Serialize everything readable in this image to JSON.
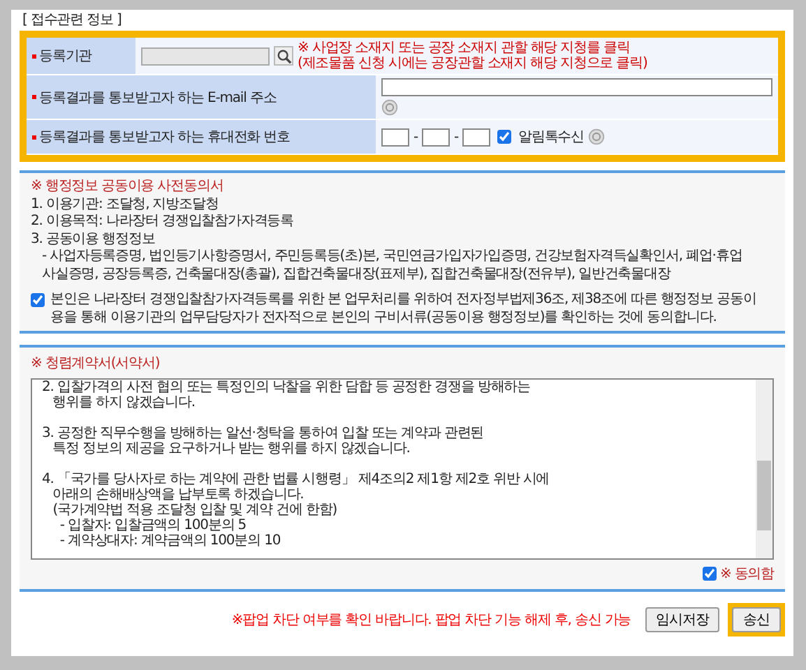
{
  "section_title": "[ 접수관련 정보 ]",
  "form": {
    "highlighted": true,
    "rows": [
      {
        "kind": "agency",
        "label": "등록기관",
        "required": true,
        "notes": [
          "※ 사업장 소재지 또는 공장 소재지 관할 해당 지청를 클릭",
          "(제조물품 신청 시에는 공장관할 소재지 해당 지청으로 클릭)"
        ]
      },
      {
        "kind": "email",
        "label": "등록결과를 통보받고자 하는 E-mail 주소",
        "required": true
      },
      {
        "kind": "phone",
        "label": "등록결과를 통보받고자 하는 휴대전화 번호",
        "required": true,
        "separators": [
          "-",
          "-"
        ],
        "sms": {
          "label": "알림톡수신",
          "checked": true
        }
      }
    ]
  },
  "consent": {
    "title": "※ 행정정보 공동이용 사전동의서",
    "lines": [
      {
        "kind": "item",
        "text": "1. 이용기관: 조달청, 지방조달청"
      },
      {
        "kind": "item",
        "text": "2. 이용목적: 나라장터 경쟁입찰참가자격등록"
      },
      {
        "kind": "item",
        "text": "3. 공동이용 행정정보"
      },
      {
        "kind": "sub",
        "text": "- 사업자등록증명, 법인등기사항증명서, 주민등록등(초)본, 국민연금가입자가입증명, 건강보험자격득실확인서, 폐업·휴업사실증명, 공장등록증, 건축물대장(총괄), 집합건축물대장(표제부), 집합건축물대장(전유부), 일반건축물대장"
      }
    ],
    "agree": {
      "checked": true,
      "text": "본인은 나라장터 경쟁입찰참가자격등록를 위한 본 업무처리를 위하여 전자정부법제36조, 제38조에 따른 행정정보 공동이용을 통해 이용기관의 업무담당자가 전자적으로 본인의 구비서류(공동이용 행정정보)를 확인하는 것에 동의합니다."
    }
  },
  "pledge": {
    "title": "※ 청렴계약서(서약서)",
    "paragraphs": [
      [
        "2. 입찰가격의 사전 협의 또는 특정인의 낙찰을 위한 담합 등 공정한 경쟁을 방해하는",
        "   행위를 하지 않겠습니다."
      ],
      [
        "3. 공정한 직무수행을 방해하는 알선·청탁을 통하여 입찰 또는 계약과 관련된",
        "   특정 정보의 제공을 요구하거나 받는 행위를 하지 않겠습니다."
      ],
      [
        "4. 「국가를 당사자로 하는 계약에 관한 법률 시행령」 제4조의2 제1항 제2호 위반 시에",
        "   아래의 손해배상액을 납부토록 하겠습니다.",
        "   (국가계약법 적용 조달청 입찰 및 계약 건에 한함)",
        "     - 입찰자: 입찰금액의 100분의 5",
        "     - 계약상대자: 계약금액의 100분의 10"
      ]
    ],
    "agree": {
      "checked": true,
      "label": "※ 동의함"
    }
  },
  "notice": "※팝업 차단 여부를 확인 바랍니다. 팝업 차단 기능 해제 후, 송신 가능",
  "buttons": [
    {
      "label": "임시저장",
      "highlighted": false
    },
    {
      "label": "송신",
      "highlighted": true
    }
  ]
}
